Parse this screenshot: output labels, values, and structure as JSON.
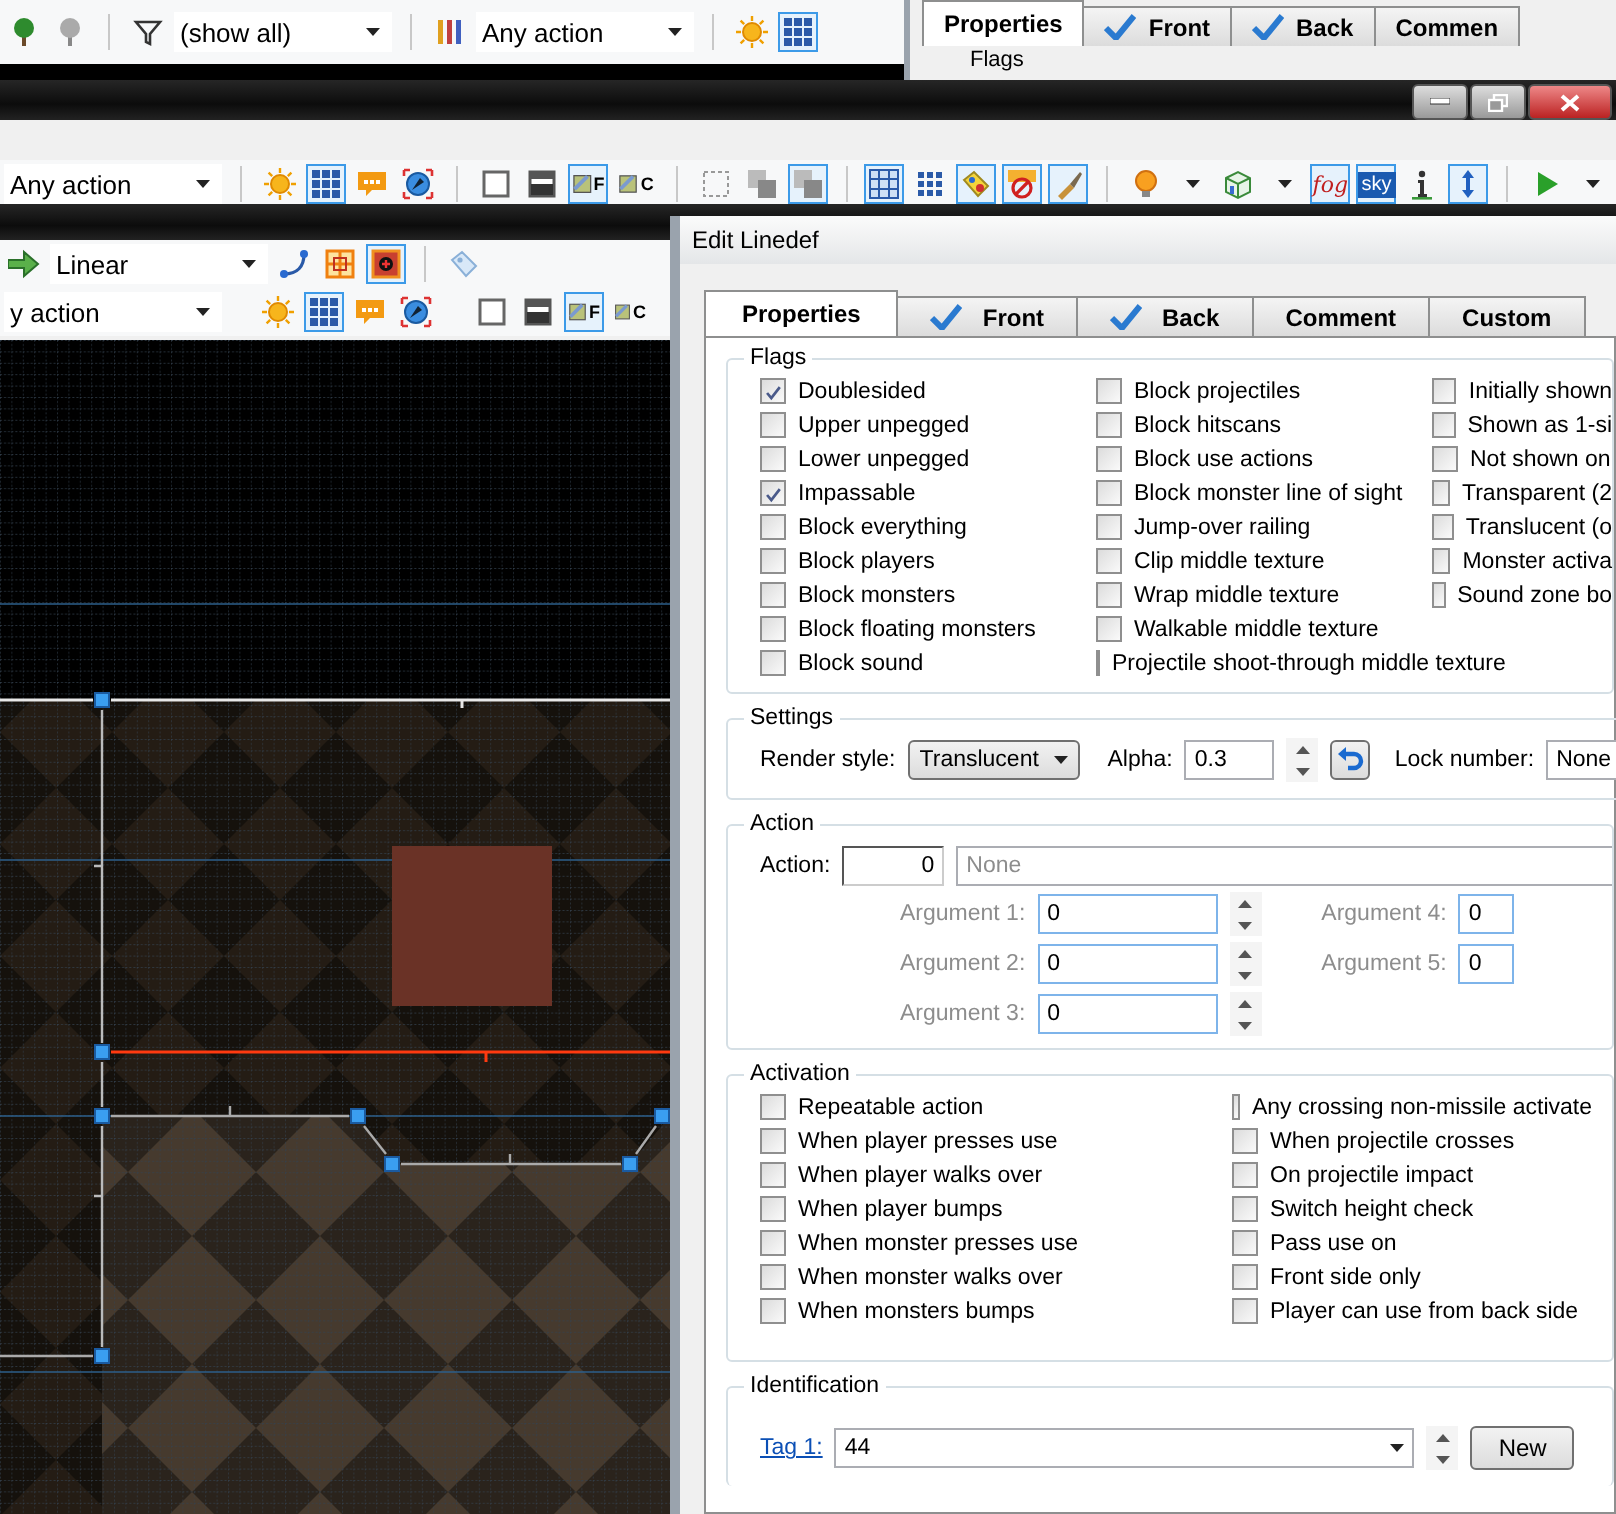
{
  "back_window": {
    "toolbar": [
      {
        "kind": "tree",
        "selected": false
      },
      {
        "kind": "tree-grey",
        "selected": false
      },
      {
        "kind": "separator"
      },
      {
        "kind": "funnel",
        "selected": false
      },
      {
        "kind": "dropdown",
        "value": "(show all)"
      },
      {
        "kind": "separator"
      },
      {
        "kind": "bars",
        "selected": false
      },
      {
        "kind": "dropdown",
        "value": "Any action"
      },
      {
        "kind": "separator"
      },
      {
        "kind": "sun",
        "selected": false
      },
      {
        "kind": "grid",
        "selected": true
      }
    ]
  },
  "back_dialog": {
    "tabs": [
      {
        "label": "Properties",
        "selected": true,
        "checked": false
      },
      {
        "label": "Front",
        "selected": false,
        "checked": true
      },
      {
        "label": "Back",
        "selected": false,
        "checked": true
      },
      {
        "label": "Commen",
        "selected": false,
        "checked": false
      }
    ],
    "group": "Flags"
  },
  "middle_window": {
    "toolbar": [
      {
        "kind": "dropdown",
        "value": "Any action"
      },
      {
        "kind": "separator"
      },
      {
        "kind": "sun",
        "selected": false
      },
      {
        "kind": "grid",
        "selected": true
      },
      {
        "kind": "comment",
        "selected": false
      },
      {
        "kind": "compass",
        "selected": false
      },
      {
        "kind": "separator"
      },
      {
        "kind": "square",
        "selected": false
      },
      {
        "kind": "half-square",
        "selected": false
      },
      {
        "kind": "texture",
        "label": "F",
        "selected": true
      },
      {
        "kind": "texture",
        "label": "C",
        "selected": false
      },
      {
        "kind": "separator"
      },
      {
        "kind": "dotted-square",
        "selected": false
      },
      {
        "kind": "stack",
        "selected": false
      },
      {
        "kind": "stack",
        "selected": true
      },
      {
        "kind": "separator"
      },
      {
        "kind": "grid-alt",
        "selected": true
      },
      {
        "kind": "dot-grid",
        "selected": false
      },
      {
        "kind": "tag-yellow",
        "selected": true
      },
      {
        "kind": "red-sign",
        "selected": true
      },
      {
        "kind": "brush",
        "selected": true
      },
      {
        "kind": "separator"
      },
      {
        "kind": "bulb",
        "selected": false,
        "menu": true
      },
      {
        "kind": "cube",
        "selected": false,
        "menu": true
      },
      {
        "kind": "text",
        "label": "fog",
        "selected": true
      },
      {
        "kind": "sky",
        "label": "sky",
        "selected": true
      },
      {
        "kind": "info",
        "selected": false
      },
      {
        "kind": "vertical-arrows",
        "selected": true
      },
      {
        "kind": "separator"
      },
      {
        "kind": "play",
        "selected": false,
        "menu": true
      }
    ]
  },
  "editor_window": {
    "toolbar_1": [
      {
        "kind": "arrow",
        "selected": false
      },
      {
        "kind": "dropdown",
        "value": "Linear"
      },
      {
        "kind": "curve",
        "selected": false
      },
      {
        "kind": "orange-grid",
        "selected": false
      },
      {
        "kind": "red-square",
        "selected": true
      },
      {
        "kind": "separator"
      },
      {
        "kind": "tag",
        "selected": false
      }
    ],
    "toolbar_2": [
      {
        "kind": "dropdown",
        "value": "y action"
      },
      {
        "kind": "separator"
      },
      {
        "kind": "sun",
        "selected": false
      },
      {
        "kind": "grid",
        "selected": true
      },
      {
        "kind": "comment",
        "selected": false
      },
      {
        "kind": "compass",
        "selected": false
      },
      {
        "kind": "separator"
      },
      {
        "kind": "square",
        "selected": false
      },
      {
        "kind": "half-square",
        "selected": false
      },
      {
        "kind": "texture",
        "label": "F",
        "selected": true
      },
      {
        "kind": "texture",
        "label": "C",
        "selected": false
      },
      {
        "kind": "separator"
      }
    ]
  },
  "dialog": {
    "title": "Edit Linedef",
    "tabs": [
      {
        "label": "Properties",
        "selected": true,
        "checked": false
      },
      {
        "label": "Front",
        "selected": false,
        "checked": true
      },
      {
        "label": "Back",
        "selected": false,
        "checked": true
      },
      {
        "label": "Comment",
        "selected": false,
        "checked": false
      },
      {
        "label": "Custom",
        "selected": false,
        "checked": false
      }
    ],
    "flags": {
      "title": "Flags",
      "columns": [
        [
          {
            "label": "Doublesided",
            "checked": true
          },
          {
            "label": "Upper unpegged",
            "checked": false
          },
          {
            "label": "Lower unpegged",
            "checked": false
          },
          {
            "label": "Impassable",
            "checked": true
          },
          {
            "label": "Block everything",
            "checked": false
          },
          {
            "label": "Block players",
            "checked": false
          },
          {
            "label": "Block monsters",
            "checked": false
          },
          {
            "label": "Block floating monsters",
            "checked": false
          },
          {
            "label": "Block sound",
            "checked": false
          }
        ],
        [
          {
            "label": "Block projectiles",
            "checked": false
          },
          {
            "label": "Block hitscans",
            "checked": false
          },
          {
            "label": "Block use actions",
            "checked": false
          },
          {
            "label": "Block monster line of sight",
            "checked": false
          },
          {
            "label": "Jump-over railing",
            "checked": false
          },
          {
            "label": "Clip middle texture",
            "checked": false
          },
          {
            "label": "Wrap middle texture",
            "checked": false
          },
          {
            "label": "Walkable middle texture",
            "checked": false
          },
          {
            "label": "Projectile shoot-through middle texture",
            "checked": false
          }
        ],
        [
          {
            "label": "Initially shown",
            "checked": false
          },
          {
            "label": "Shown as 1-si",
            "checked": false
          },
          {
            "label": "Not shown on",
            "checked": false
          },
          {
            "label": "Transparent (2",
            "checked": false
          },
          {
            "label": "Translucent (o",
            "checked": false
          },
          {
            "label": "Monster activa",
            "checked": false
          },
          {
            "label": "Sound zone bo",
            "checked": false
          }
        ]
      ]
    },
    "settings": {
      "title": "Settings",
      "render_style_label": "Render style:",
      "render_style": "Translucent",
      "alpha_label": "Alpha:",
      "alpha": "0.3",
      "lock_label": "Lock number:",
      "lock": "None"
    },
    "action": {
      "title": "Action",
      "label": "Action:",
      "number": "0",
      "name": "None",
      "arguments": [
        {
          "label": "Argument 1:",
          "value": "0",
          "disabled": true
        },
        {
          "label": "Argument 2:",
          "value": "0",
          "disabled": true
        },
        {
          "label": "Argument 3:",
          "value": "0",
          "disabled": true
        },
        {
          "label": "Argument 4:",
          "value": "0",
          "disabled": true
        },
        {
          "label": "Argument 5:",
          "value": "0",
          "disabled": true
        }
      ]
    },
    "activation": {
      "title": "Activation",
      "columns": [
        [
          {
            "label": "Repeatable action",
            "checked": false
          },
          {
            "label": "When player presses use",
            "checked": false
          },
          {
            "label": "When player walks over",
            "checked": false
          },
          {
            "label": "When player bumps",
            "checked": false
          },
          {
            "label": "When monster presses use",
            "checked": false
          },
          {
            "label": "When monster walks over",
            "checked": false
          },
          {
            "label": "When monsters bumps",
            "checked": false
          }
        ],
        [
          {
            "label": "Any crossing non-missile activate",
            "checked": false
          },
          {
            "label": "When projectile crosses",
            "checked": false
          },
          {
            "label": "On projectile impact",
            "checked": false
          },
          {
            "label": "Switch height check",
            "checked": false
          },
          {
            "label": "Pass use on",
            "checked": false
          },
          {
            "label": "Front side only",
            "checked": false
          },
          {
            "label": "Player can use from back side",
            "checked": false
          }
        ]
      ]
    },
    "identification": {
      "title": "Identification",
      "tag_label": "Tag 1:",
      "tag": "44",
      "new_button": "New"
    }
  }
}
